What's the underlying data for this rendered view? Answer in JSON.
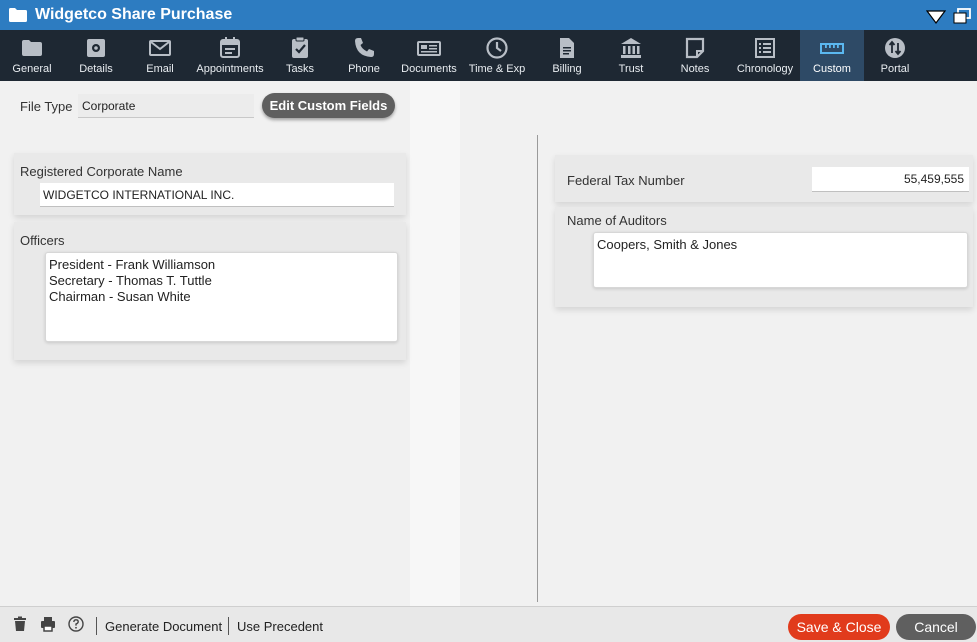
{
  "window": {
    "title": "Widgetco Share Purchase"
  },
  "tabs": [
    {
      "label": "General",
      "icon": "folder-icon"
    },
    {
      "label": "Details",
      "icon": "gear-doc-icon"
    },
    {
      "label": "Email",
      "icon": "envelope-icon"
    },
    {
      "label": "Appointments",
      "icon": "calendar-icon"
    },
    {
      "label": "Tasks",
      "icon": "clipboard-check-icon"
    },
    {
      "label": "Phone",
      "icon": "phone-icon"
    },
    {
      "label": "Documents",
      "icon": "documents-icon"
    },
    {
      "label": "Time & Exp",
      "icon": "clock-icon"
    },
    {
      "label": "Billing",
      "icon": "bill-icon"
    },
    {
      "label": "Trust",
      "icon": "bank-icon"
    },
    {
      "label": "Notes",
      "icon": "note-icon"
    },
    {
      "label": "Chronology",
      "icon": "list-icon"
    },
    {
      "label": "Custom",
      "icon": "ruler-icon",
      "active": true
    },
    {
      "label": "Portal",
      "icon": "portal-icon"
    }
  ],
  "left": {
    "file_type_label": "File Type",
    "file_type_value": "Corporate",
    "edit_button": "Edit Custom Fields",
    "corp_name_label": "Registered Corporate Name",
    "corp_name_value": "WIDGETCO INTERNATIONAL INC.",
    "officers_label": "Officers",
    "officers_lines": [
      "President - Frank Williamson",
      "Secretary - Thomas T. Tuttle",
      "Chairman - Susan White"
    ]
  },
  "right": {
    "tax_label": "Federal Tax Number",
    "tax_value": "55,459,555",
    "auditors_label": "Name of Auditors",
    "auditors_value": "Coopers, Smith & Jones"
  },
  "footer": {
    "generate": "Generate Document",
    "precedent": "Use Precedent",
    "save": "Save & Close",
    "cancel": "Cancel"
  },
  "colors": {
    "titlebar": "#2d7cc1",
    "tabbar": "#1e2833",
    "active_tab": "#2e4a66",
    "active_icon": "#5bb8f0",
    "save": "#e13b1c",
    "neutral_button": "#5f5f5f"
  }
}
